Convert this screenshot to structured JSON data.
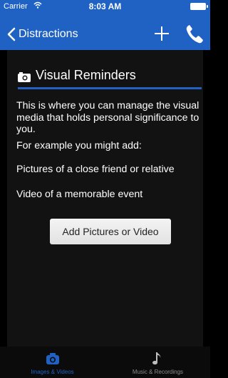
{
  "status": {
    "carrier": "Carrier",
    "time": "8:03 AM"
  },
  "nav": {
    "back_label": "Distractions"
  },
  "section": {
    "title": "Visual Reminders"
  },
  "body": {
    "intro": "This is where you can manage the visual media that holds personal significance to you.",
    "example_intro": "For example you might add:",
    "example_1": "Pictures of a close friend or relative",
    "example_2": "Video of a memorable event"
  },
  "add_button_label": "Add Pictures or Video",
  "tabs": [
    {
      "label": "Images & Videos",
      "icon": "camera-icon",
      "selected": true
    },
    {
      "label": "Music & Recordings",
      "icon": "music-note-icon",
      "selected": false
    }
  ],
  "colors": {
    "accent": "#1f62c4",
    "background": "#000000",
    "panel": "#121212"
  }
}
